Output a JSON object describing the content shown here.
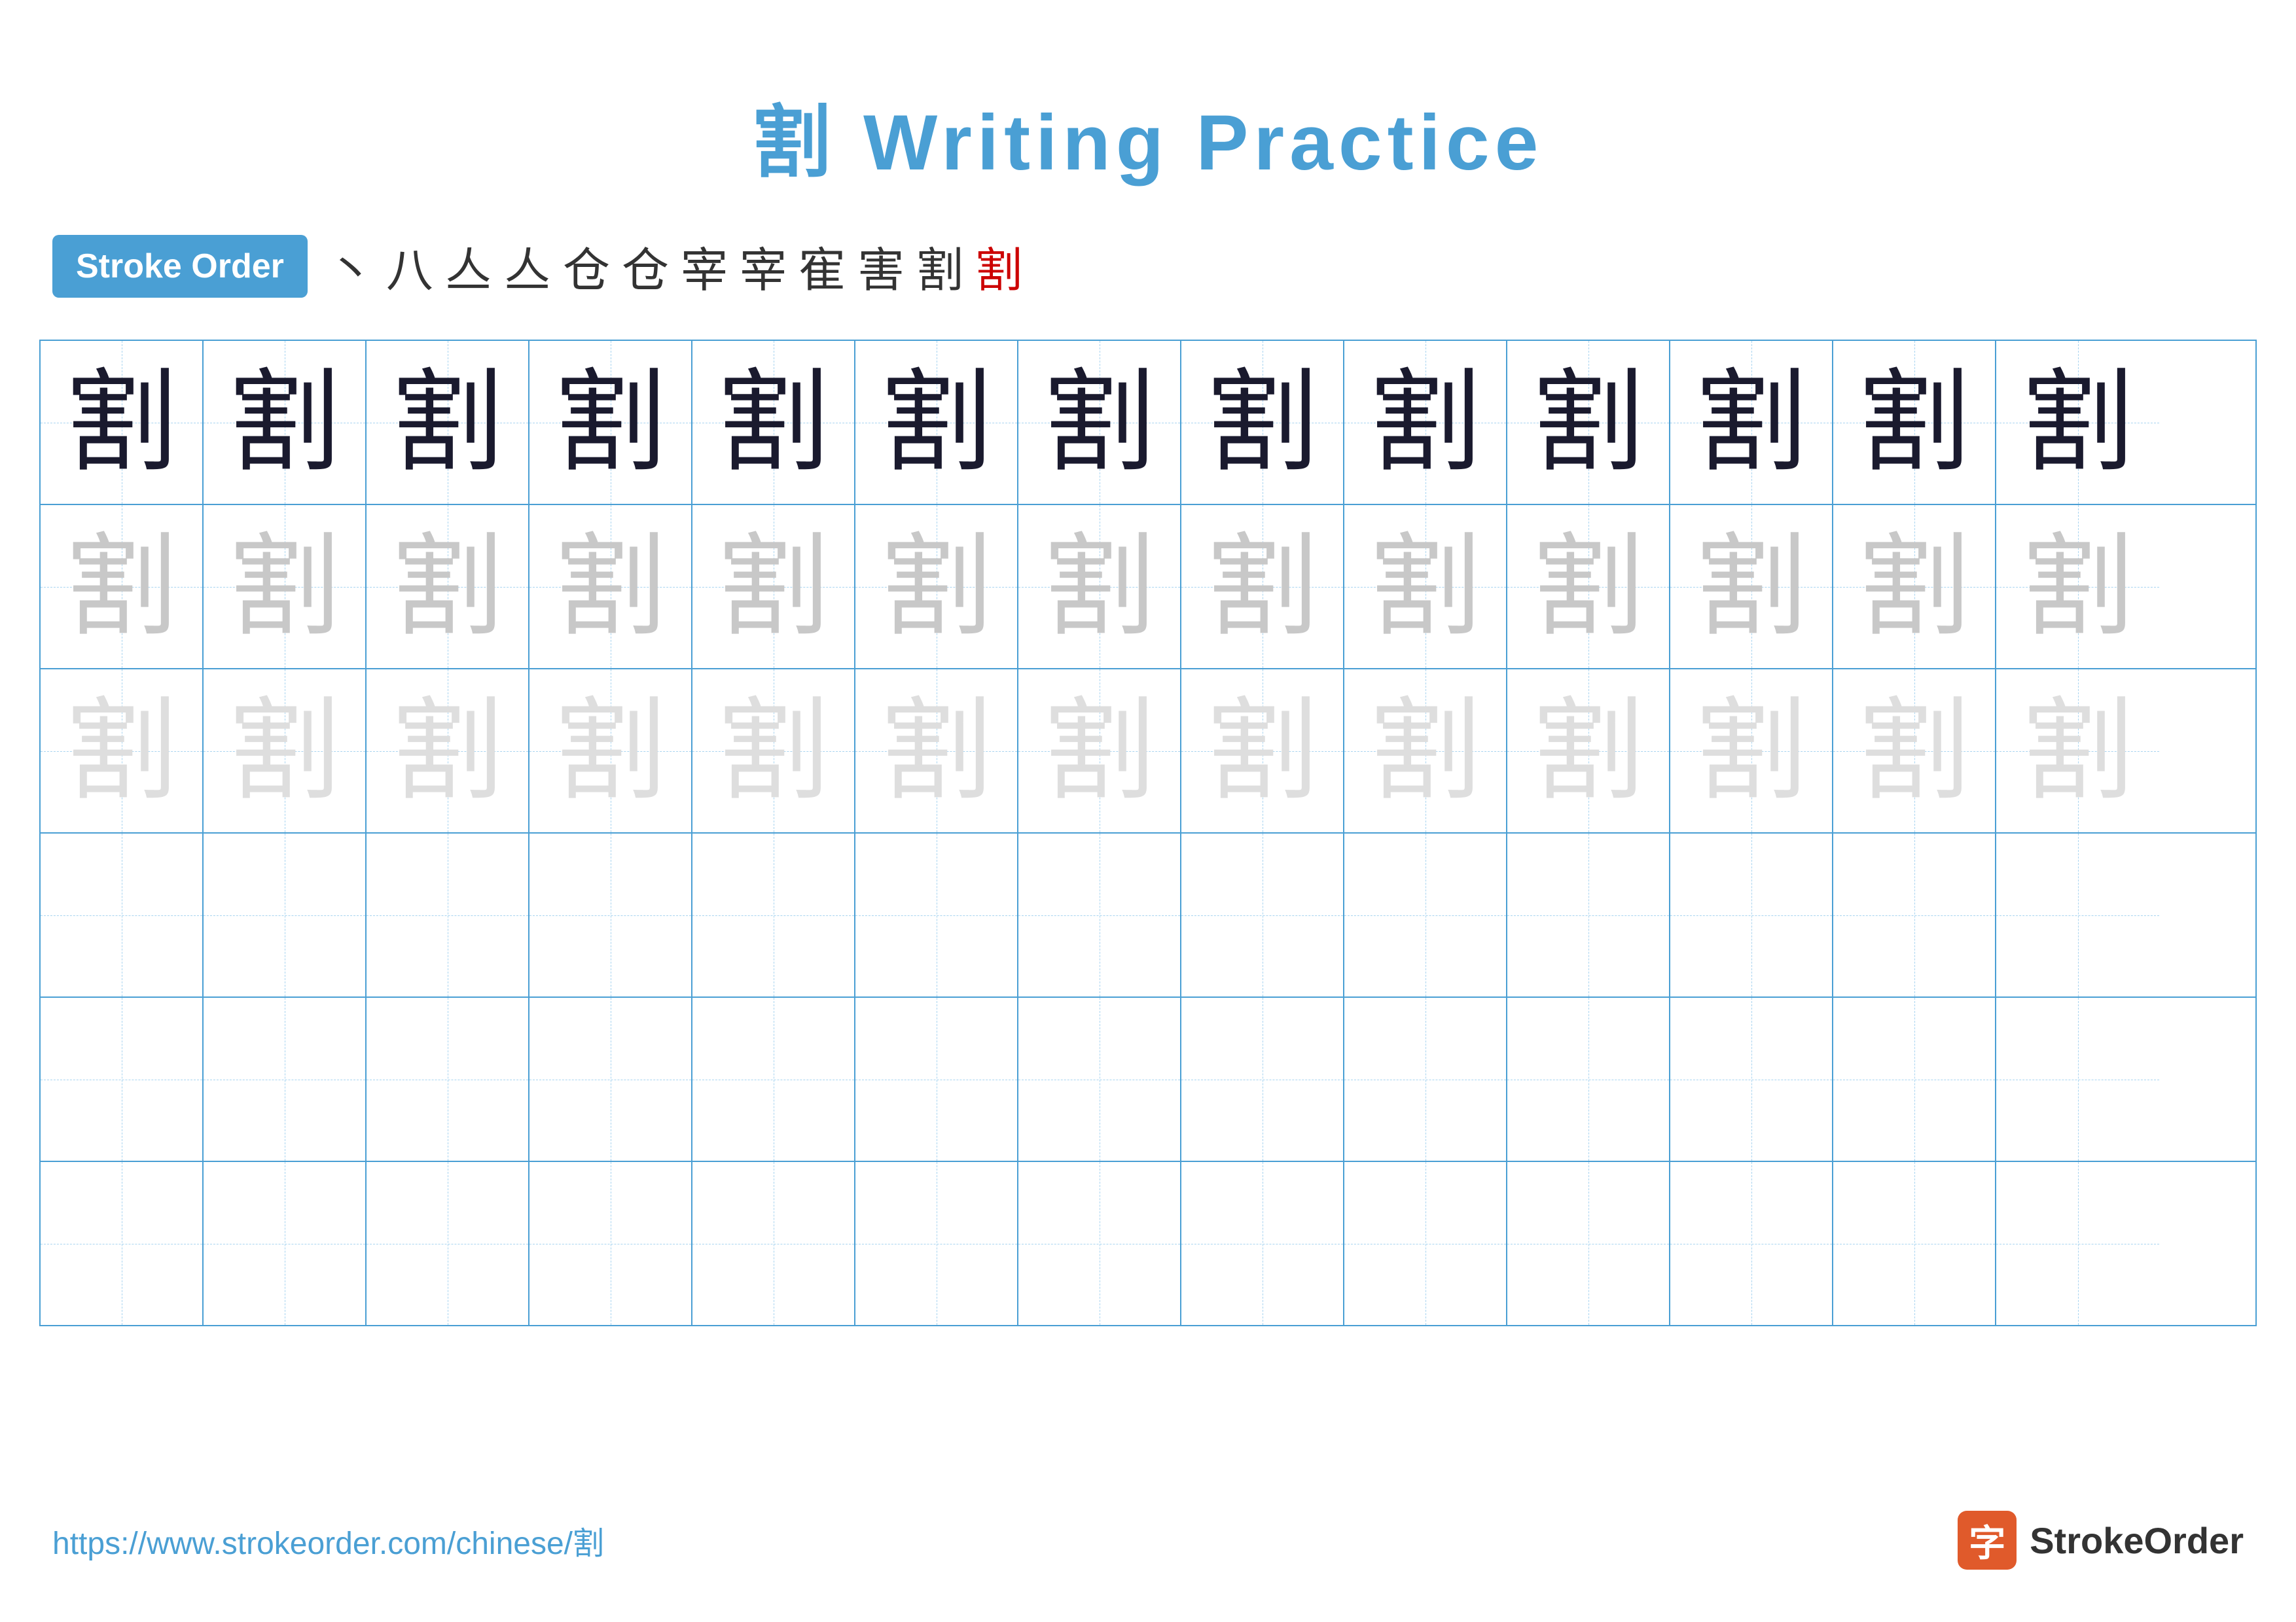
{
  "page": {
    "title": "割 Writing Practice",
    "stroke_order_badge": "Stroke Order",
    "stroke_sequence": [
      "丶",
      "八",
      "亼",
      "亼",
      "仓",
      "仓",
      "宰",
      "宰",
      "寉",
      "害",
      "割",
      "割"
    ],
    "character": "割",
    "url": "https://www.strokeorder.com/chinese/割",
    "brand_name": "StrokeOrder",
    "brand_icon_char": "字"
  },
  "grid": {
    "rows": 6,
    "cols": 13,
    "row_types": [
      "dark",
      "medium",
      "light",
      "empty",
      "empty",
      "empty"
    ]
  }
}
